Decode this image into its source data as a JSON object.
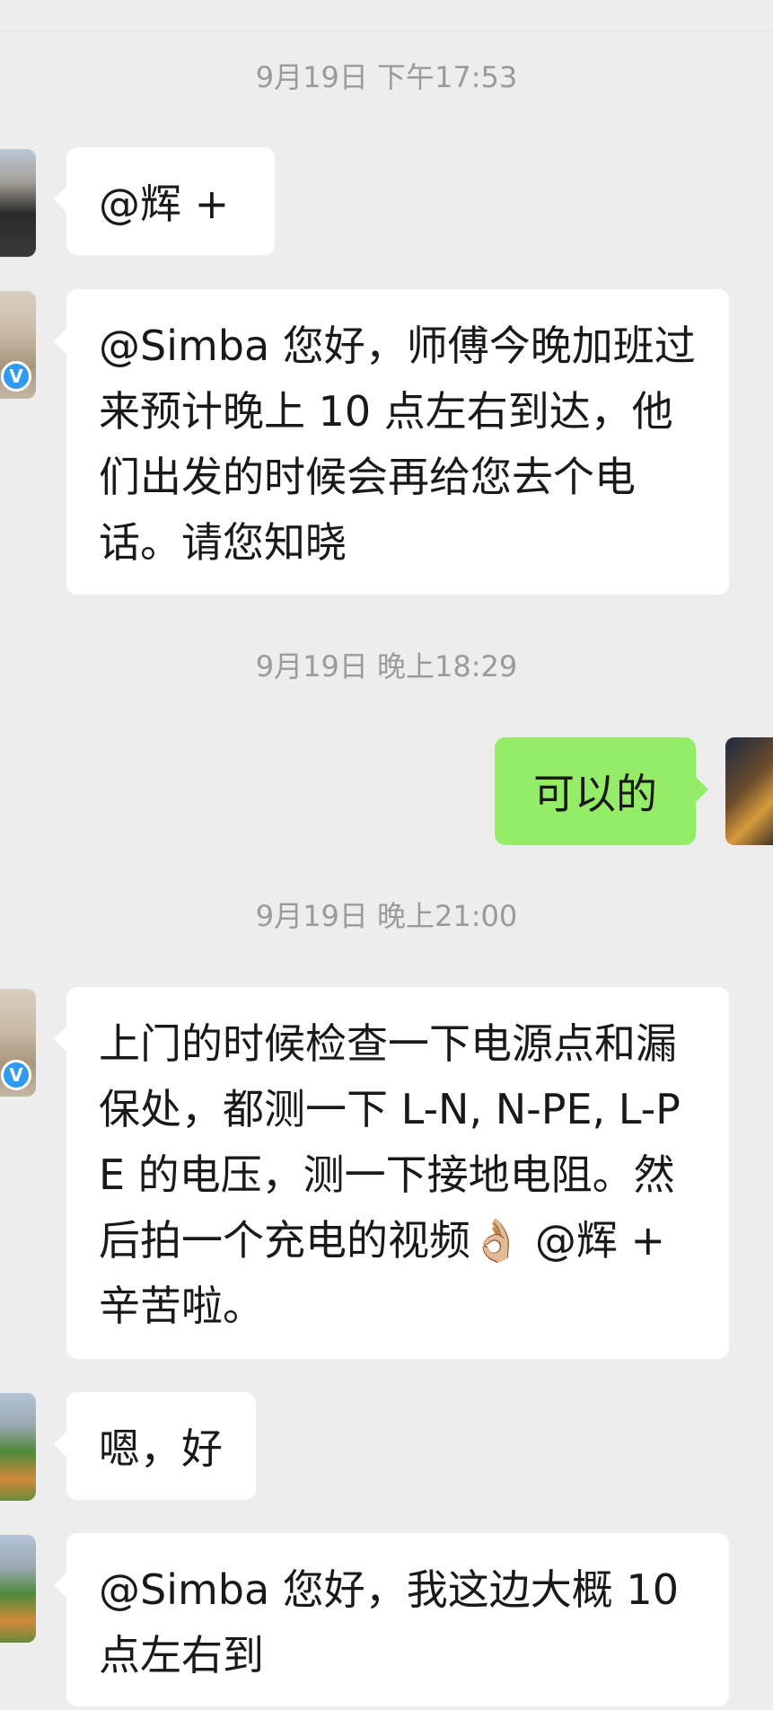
{
  "messages": [
    {
      "type": "timestamp",
      "text": "9月19日 下午17:53"
    },
    {
      "type": "message",
      "side": "left",
      "avatar": "person-avatar",
      "verified": false,
      "text": "@辉 +"
    },
    {
      "type": "message",
      "side": "left",
      "avatar": "field-avatar",
      "verified": true,
      "text": "@Simba 您好，师傅今晚加班过来预计晚上 10 点左右到达，他们出发的时候会再给您去个电话。请您知晓"
    },
    {
      "type": "timestamp",
      "text": "9月19日 晚上18:29"
    },
    {
      "type": "message",
      "side": "right",
      "avatar": "lion-avatar",
      "verified": false,
      "text": "可以的"
    },
    {
      "type": "timestamp",
      "text": "9月19日 晚上21:00"
    },
    {
      "type": "message",
      "side": "left",
      "avatar": "field-avatar",
      "verified": true,
      "text": "上门的时候检查一下电源点和漏保处，都测一下 L-N, N-PE, L-PE 的电压，测一下接地电阻。然后拍一个充电的视频👌🏼 @辉 +  辛苦啦。"
    },
    {
      "type": "message",
      "side": "left",
      "avatar": "green-avatar",
      "verified": false,
      "text": "嗯，好"
    },
    {
      "type": "message",
      "side": "left",
      "avatar": "green-avatar",
      "verified": false,
      "text": "@Simba 您好，我这边大概 10 点左右到"
    }
  ],
  "verified_badge": "V",
  "colors": {
    "background": "#ededed",
    "bubble_left": "#ffffff",
    "bubble_right": "#95ec69",
    "timestamp": "#9a9a9a",
    "verified": "#2f9bf0"
  }
}
